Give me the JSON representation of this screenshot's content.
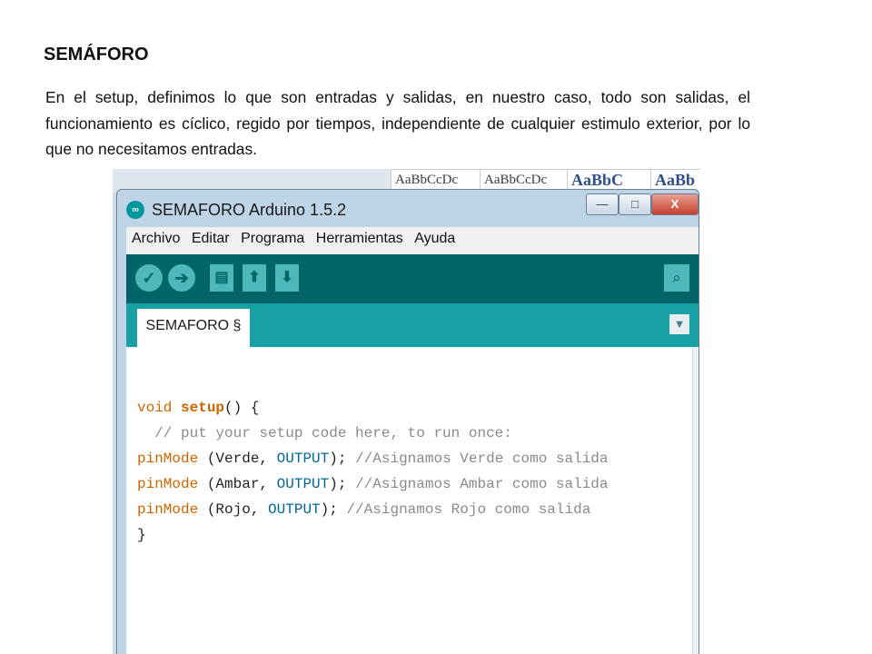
{
  "slide": {
    "title": "SEMÁFORO",
    "paragraph": "En el setup, definimos lo que son entradas y salidas, en nuestro caso, todo son salidas, el funcionamiento es cíclico, regido por tiempos, independiente de cualquier estimulo exterior, por lo que no necesitamos entradas."
  },
  "background_ribbon": {
    "fragments": [
      "AaBbCcDc",
      "AaBbCcDc",
      "AaBbC",
      "AaBb"
    ]
  },
  "window": {
    "title": "SEMAFORO Arduino 1.5.2",
    "app_icon": "∞",
    "controls": {
      "minimize": "—",
      "maximize": "□",
      "close": "X"
    }
  },
  "menubar": {
    "items": [
      "Archivo",
      "Editar",
      "Programa",
      "Herramientas",
      "Ayuda"
    ]
  },
  "toolbar": {
    "verify": "✓",
    "upload": "➔",
    "new": "▤",
    "open": "⬆",
    "save": "⬇",
    "serial_monitor": "⌕"
  },
  "tabs": {
    "active": "SEMAFORO §",
    "menu": "▼"
  },
  "code": {
    "line1": {
      "kw": "void",
      "fn": "setup",
      "rest": "() {"
    },
    "line2": {
      "comment": "  // put your setup code here, to run once:"
    },
    "line3": {
      "fn": "pinMode",
      "open": " (Verde, ",
      "const": "OUTPUT",
      "close": "); ",
      "comment": "//Asignamos Verde como salida"
    },
    "line4": {
      "fn": "pinMode",
      "open": " (Ambar, ",
      "const": "OUTPUT",
      "close": "); ",
      "comment": "//Asignamos Ambar como salida"
    },
    "line5": {
      "fn": "pinMode",
      "open": " (Rojo, ",
      "const": "OUTPUT",
      "close": "); ",
      "comment": "//Asignamos Rojo como salida"
    },
    "line6": {
      "text": "}"
    }
  },
  "colors": {
    "toolbar": "#006468",
    "tabbar": "#17a1a5",
    "keyword": "#cc6600",
    "constant": "#006699",
    "comment": "#8a8a8a"
  }
}
